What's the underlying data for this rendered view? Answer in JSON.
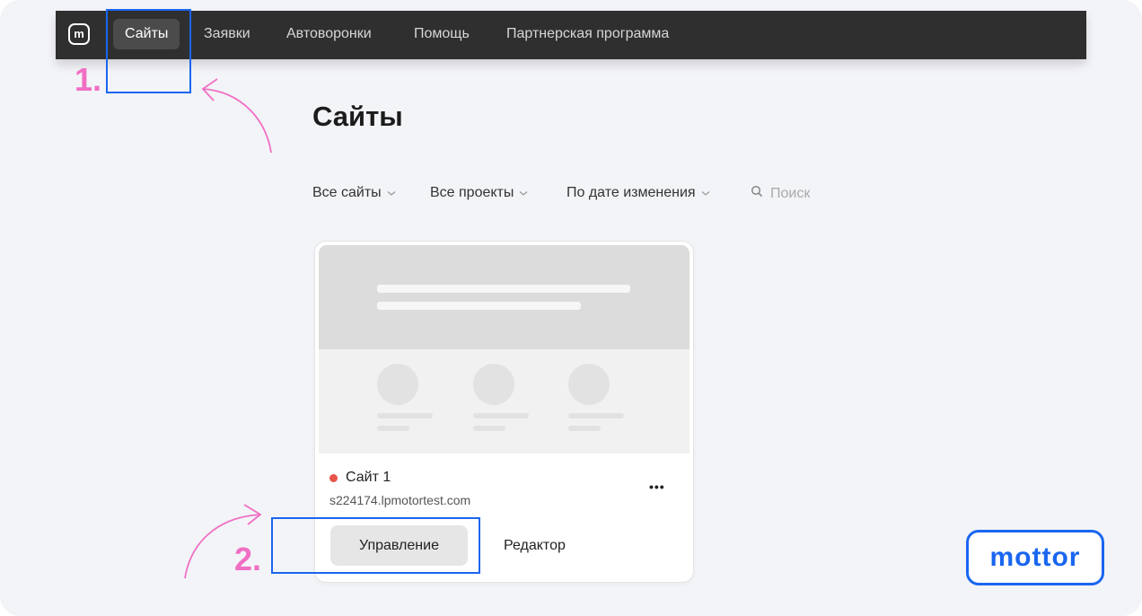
{
  "nav": {
    "logo_letter": "m",
    "items": [
      {
        "label": "Сайты",
        "active": true
      },
      {
        "label": "Заявки",
        "active": false
      },
      {
        "label": "Автоворонки",
        "active": false
      },
      {
        "label": "Помощь",
        "active": false
      },
      {
        "label": "Партнерская программа",
        "active": false
      }
    ]
  },
  "page": {
    "title": "Сайты"
  },
  "filters": {
    "sites": "Все сайты",
    "projects": "Все проекты",
    "sort": "По дате изменения",
    "search_placeholder": "Поиск"
  },
  "card": {
    "name": "Сайт 1",
    "url": "s224174.lpmotortest.com",
    "status_color": "#e8544a",
    "more_label": "•••",
    "manage_label": "Управление",
    "editor_label": "Редактор"
  },
  "annotations": {
    "step1": "1.",
    "step2": "2.",
    "highlight_color": "#1a66f0",
    "arrow_color": "#f06fc3"
  },
  "brand": {
    "text": "mottor"
  }
}
